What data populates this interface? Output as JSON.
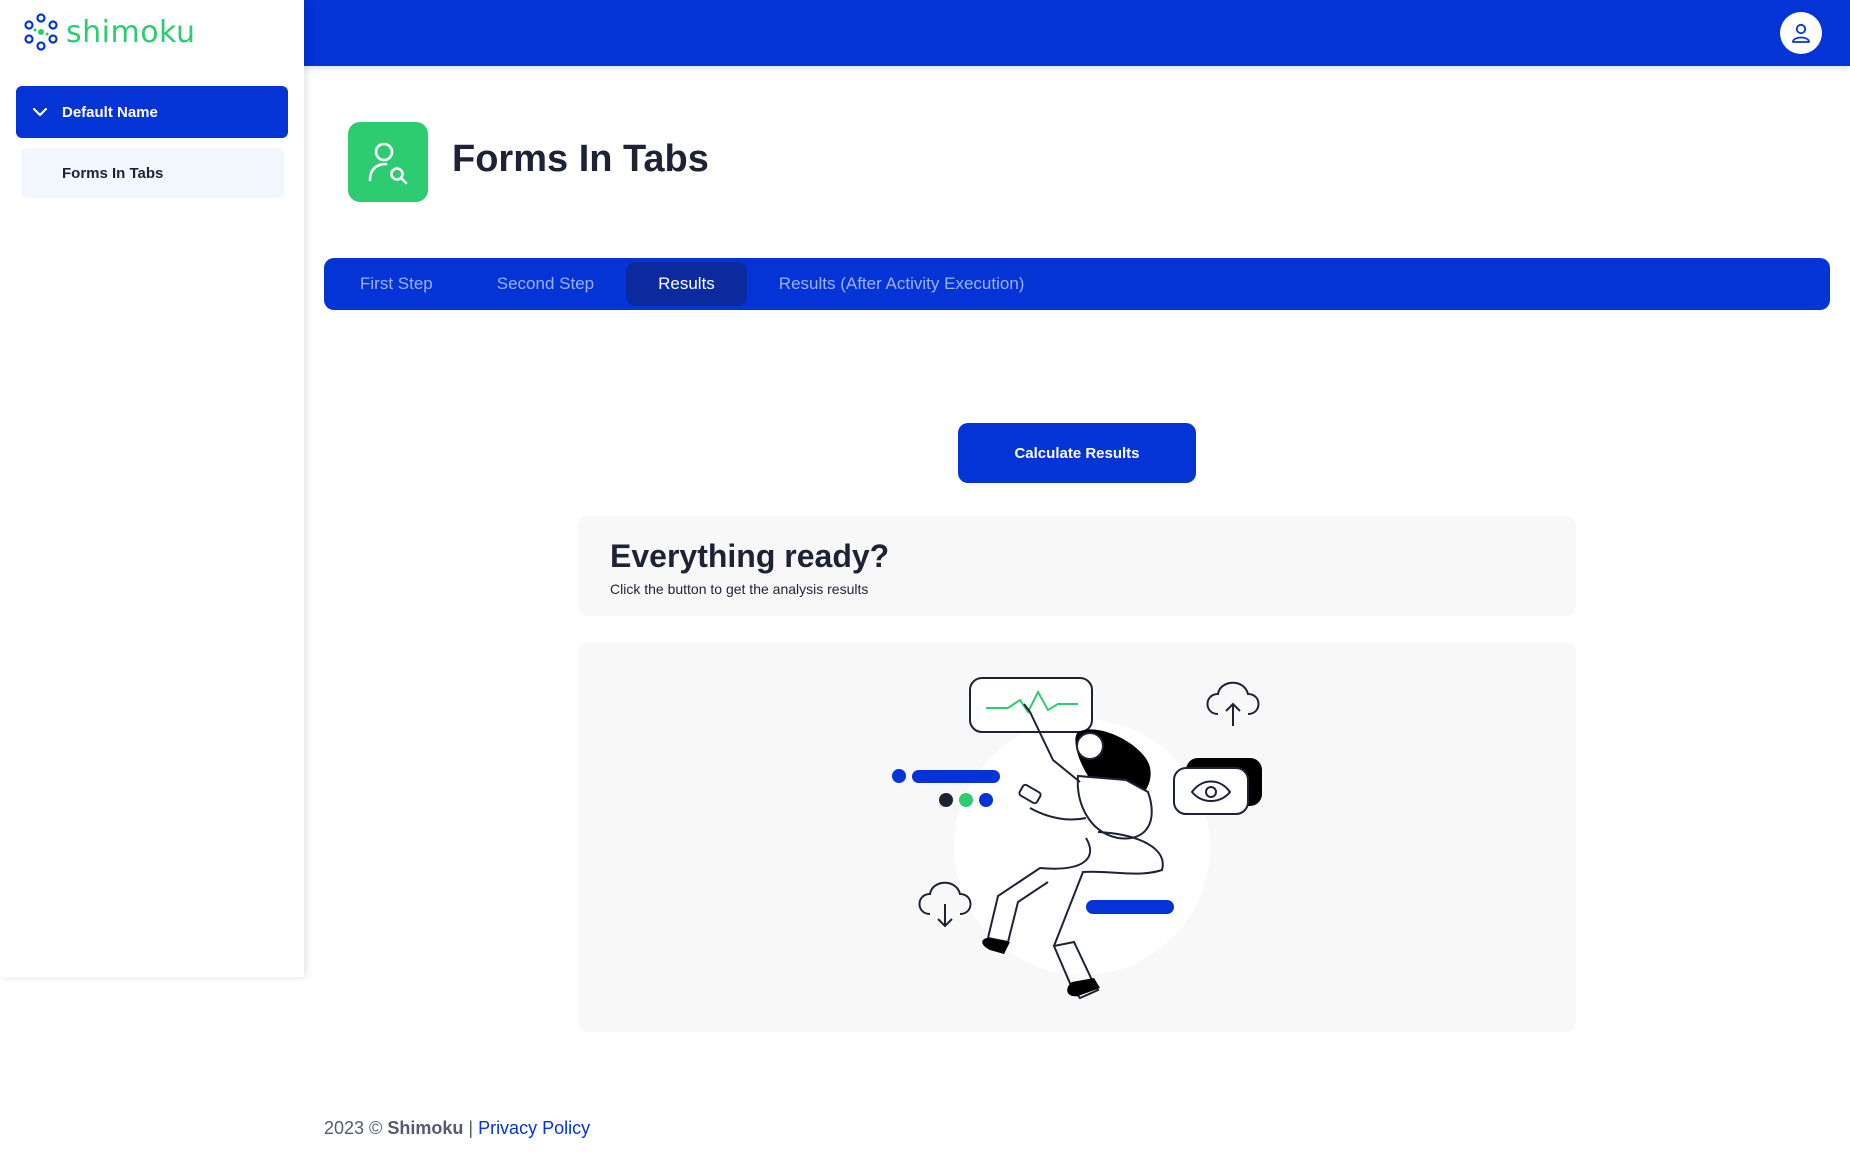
{
  "brand": {
    "name": "shimoku",
    "primary": "#0433d6",
    "accent": "#2ecc71"
  },
  "sidebar": {
    "group": {
      "label": "Default Name",
      "icon": "chevron-down-icon"
    },
    "items": [
      {
        "label": "Forms In Tabs"
      }
    ]
  },
  "header": {
    "avatar_icon": "user-icon"
  },
  "page": {
    "title": "Forms In Tabs",
    "icon": "user-search-icon"
  },
  "tabs": [
    {
      "label": "First Step",
      "active": false
    },
    {
      "label": "Second Step",
      "active": false
    },
    {
      "label": "Results",
      "active": true
    },
    {
      "label": "Results (After Activity Execution)",
      "active": false
    }
  ],
  "results": {
    "button_label": "Calculate Results",
    "card_title": "Everything ready?",
    "card_subtitle": "Click the button to get the analysis results",
    "illustration": "woman-pointing-at-chart-illustration"
  },
  "footer": {
    "year": "2023 ©",
    "company": "Shimoku",
    "separator": "|",
    "privacy": "Privacy Policy"
  }
}
